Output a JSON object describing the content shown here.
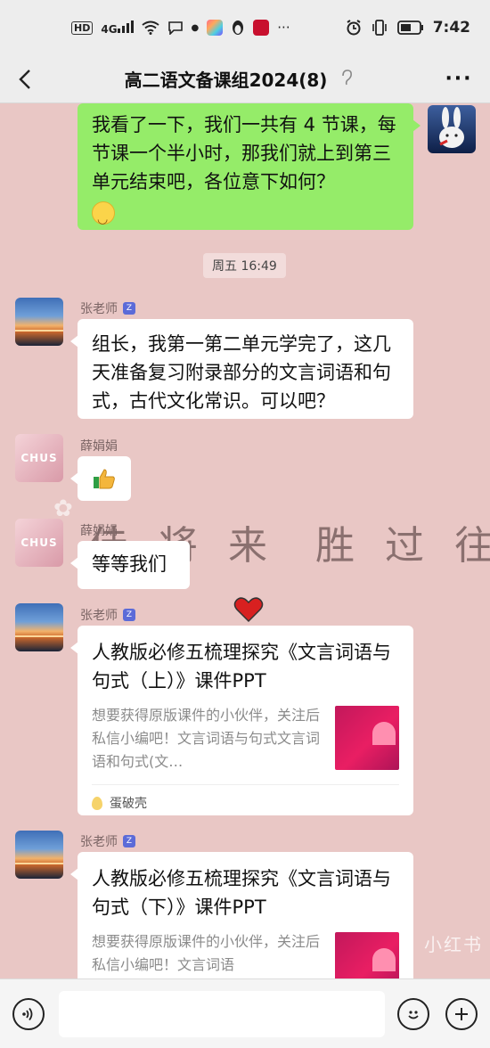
{
  "status_bar": {
    "network_badge": "HD",
    "signal": "4G",
    "time": "7:42",
    "icons": [
      "hd-icon",
      "signal-icon",
      "wifi-icon",
      "chat-bubble-icon",
      "dot-icon",
      "app-icon",
      "penguin-icon",
      "news-app-icon",
      "more-dots-icon",
      "alarm-icon",
      "vibrate-icon",
      "battery-icon"
    ]
  },
  "header": {
    "title": "高二语文备课组2024(8)",
    "icons": [
      "back-arrow-icon",
      "ear-icon",
      "more-icon"
    ]
  },
  "messages": {
    "m1": {
      "text": "我看了一下，我们一共有 4 节课，每节课一个半小时，那我们就上到第三单元结束吧，各位意下如何？"
    },
    "timestamp": "周五 16:49",
    "m2": {
      "sender": "张老师",
      "text": "组长，我第一第二单元学完了，这几天准备复习附录部分的文言词语和句式，古代文化常识。可以吧？"
    },
    "m3": {
      "sender": "薛娟娟",
      "emoji": "thumbs-up-icon"
    },
    "m4": {
      "sender": "薛娟娟",
      "text": "等等我们"
    },
    "m5": {
      "sender": "张老师",
      "title": "人教版必修五梳理探究《文言词语与句式（上）》课件PPT",
      "desc": "想要获得原版课件的小伙伴，关注后私信小编吧！文言词语与句式文言词语和句式(文…",
      "source": "蛋破壳"
    },
    "m6": {
      "sender": "张老师",
      "title": "人教版必修五梳理探究《文言词语与句式（下）》课件PPT",
      "desc": "想要获得原版课件的小伙伴，关注后私信小编吧！文言词语"
    }
  },
  "wallpaper": {
    "text_a": "佳 将 来",
    "text_b": "胜 过 往",
    "corner_mark": "小红书"
  },
  "input": {
    "placeholder": ""
  },
  "colors": {
    "own_bubble": "#95ec69",
    "chat_background": "#e9c7c5",
    "bar_background": "#ededed"
  }
}
